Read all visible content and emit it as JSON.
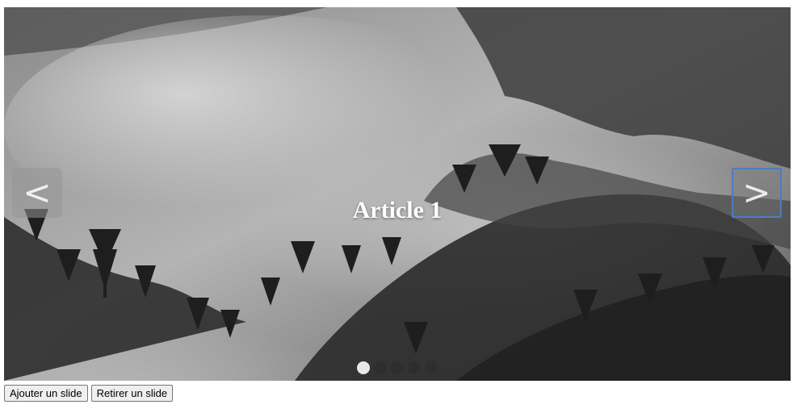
{
  "carousel": {
    "slide_title": "Article 1",
    "prev_glyph": "<",
    "next_glyph": ">",
    "prev_icon": "chevron-left-icon",
    "next_icon": "chevron-right-icon",
    "slide_count": 5,
    "active_slide": 1,
    "image_description": "misty forest hillside"
  },
  "controls": {
    "add_label": "Ajouter un slide",
    "remove_label": "Retirer un slide"
  },
  "colors": {
    "dot_active": "#e8e8e8",
    "dot_inactive": "#2e2e2e",
    "focus_outline": "#4f7bc2"
  }
}
